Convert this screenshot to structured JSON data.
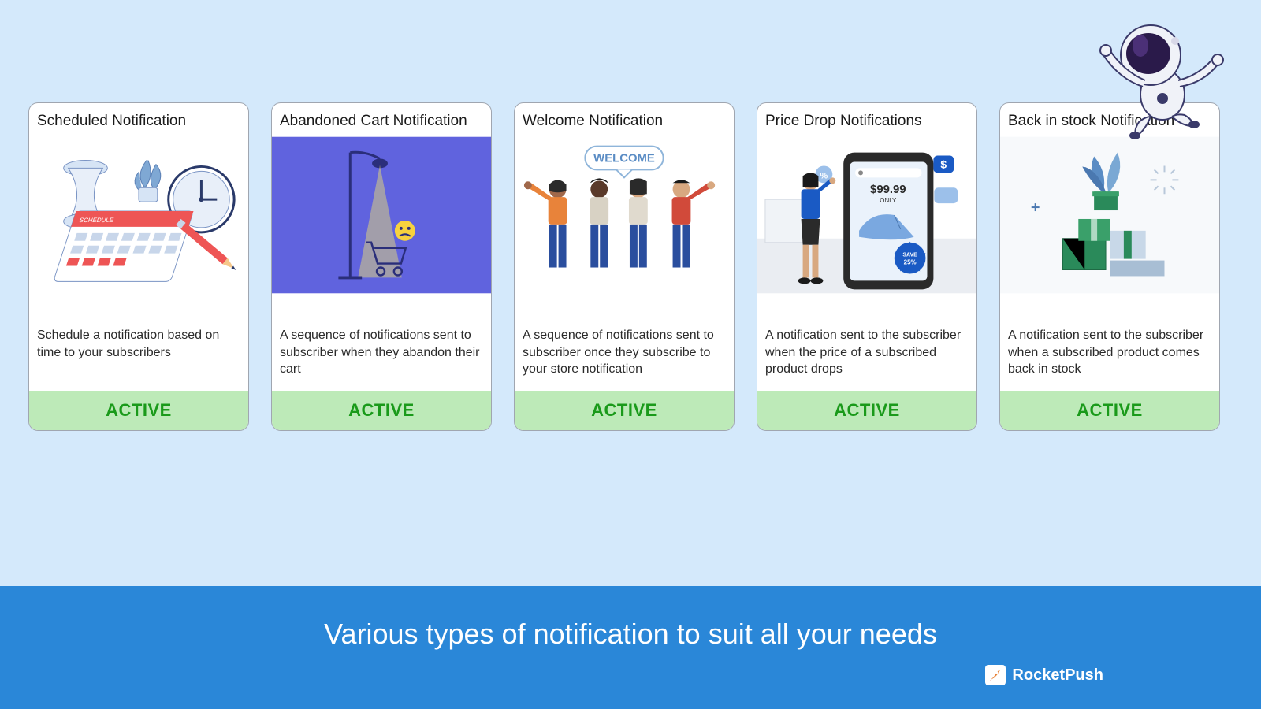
{
  "cards": [
    {
      "title": "Scheduled Notification",
      "description": "Schedule a notification based on time to your subscribers",
      "status": "ACTIVE",
      "illustration": "scheduled"
    },
    {
      "title": "Abandoned Cart Notification",
      "description": "A sequence of notifications sent to subscriber when they abandon their cart",
      "status": "ACTIVE",
      "illustration": "abandoned"
    },
    {
      "title": "Welcome Notification",
      "description": "A sequence of notifications sent to subscriber once they subscribe to your store notification",
      "status": "ACTIVE",
      "illustration": "welcome"
    },
    {
      "title": "Price Drop Notifications",
      "description": "A notification sent to the subscriber when the price of a subscribed product drops",
      "status": "ACTIVE",
      "illustration": "pricedrop",
      "price_label": "$99.99",
      "price_sub": "ONLY",
      "save_label": "SAVE 25%"
    },
    {
      "title": "Back in stock Notification",
      "description": "A notification sent to the subscriber when a subscribed product comes back in stock",
      "status": "ACTIVE",
      "illustration": "backinstock"
    }
  ],
  "welcome_bubble": "WELCOME",
  "footer": {
    "heading": "Various types of notification to suit all your needs",
    "brand": "RocketPush"
  }
}
